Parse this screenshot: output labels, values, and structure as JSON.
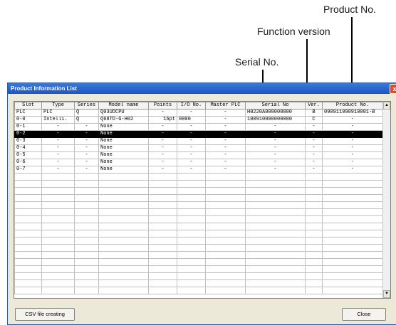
{
  "callouts": {
    "product_no": "Product No.",
    "function_version": "Function version",
    "serial_no": "Serial No."
  },
  "window": {
    "title": "Product Information List",
    "close_glyph": "x"
  },
  "table": {
    "columns": [
      "Slot",
      "Type",
      "Series",
      "Model name",
      "Points",
      "I/O No.",
      "Master PLC",
      "Serial No",
      "Ver.",
      "Product No."
    ],
    "rows": [
      [
        "PLC",
        "PLC",
        "Q",
        "Q03UDCPU",
        "-",
        "-",
        "-",
        "H0220A000000000",
        "B",
        "090911090910001-B"
      ],
      [
        "0-0",
        "Intelli.",
        "Q",
        "Q68TD-G-H02",
        "16pt",
        "0000",
        "-",
        "100910000000000",
        "C",
        "-"
      ],
      [
        "0-1",
        "-",
        "-",
        "None",
        "-",
        "-",
        "-",
        "-",
        "-",
        "-"
      ],
      [
        "0-2",
        "-",
        "-",
        "None",
        "-",
        "-",
        "-",
        "-",
        "-",
        "-"
      ],
      [
        "0-3",
        "-",
        "-",
        "None",
        "-",
        "-",
        "-",
        "-",
        "-",
        "-"
      ],
      [
        "0-4",
        "-",
        "-",
        "None",
        "-",
        "-",
        "-",
        "-",
        "-",
        "-"
      ],
      [
        "0-5",
        "-",
        "-",
        "None",
        "-",
        "-",
        "-",
        "-",
        "-",
        "-"
      ],
      [
        "0-6",
        "-",
        "-",
        "None",
        "-",
        "-",
        "-",
        "-",
        "-",
        "-"
      ],
      [
        "0-7",
        "-",
        "-",
        "None",
        "-",
        "-",
        "-",
        "-",
        "-",
        "-"
      ]
    ],
    "selected_row": 3,
    "empty_rows": 17
  },
  "scrollbar": {
    "up": "▲",
    "down": "▼"
  },
  "buttons": {
    "csv": "CSV file creating",
    "close": "Close"
  }
}
